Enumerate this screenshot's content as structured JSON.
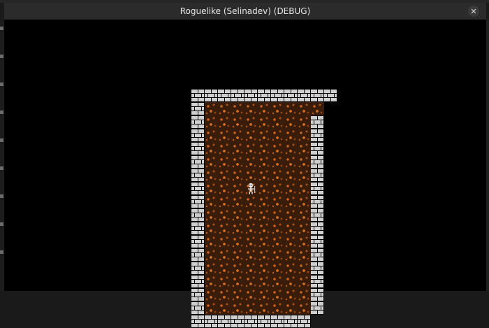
{
  "window": {
    "title": "Roguelike (Selinadev) (DEBUG)",
    "close_glyph": "✕"
  },
  "map": {
    "tile_size_note": "top-left tile of wall ring",
    "rows": [
      "###########",
      "#.........",
      "#........#",
      "#........#",
      "#........#",
      "#........#",
      "#........#",
      "#...@....#",
      "#........#",
      "#........#",
      "#........#",
      "#........#",
      "#........#",
      "#........#",
      "#........#",
      "#........#",
      "#........#",
      "#########"
    ],
    "legend": {
      "#": "brick-wall",
      ".": "dirt-floor",
      "@": "player-skeleton"
    },
    "colors": {
      "wall": "#cfcfcf",
      "floor": "#3a1c0a",
      "floor_accent": "#c8621c",
      "background": "#000000"
    }
  }
}
